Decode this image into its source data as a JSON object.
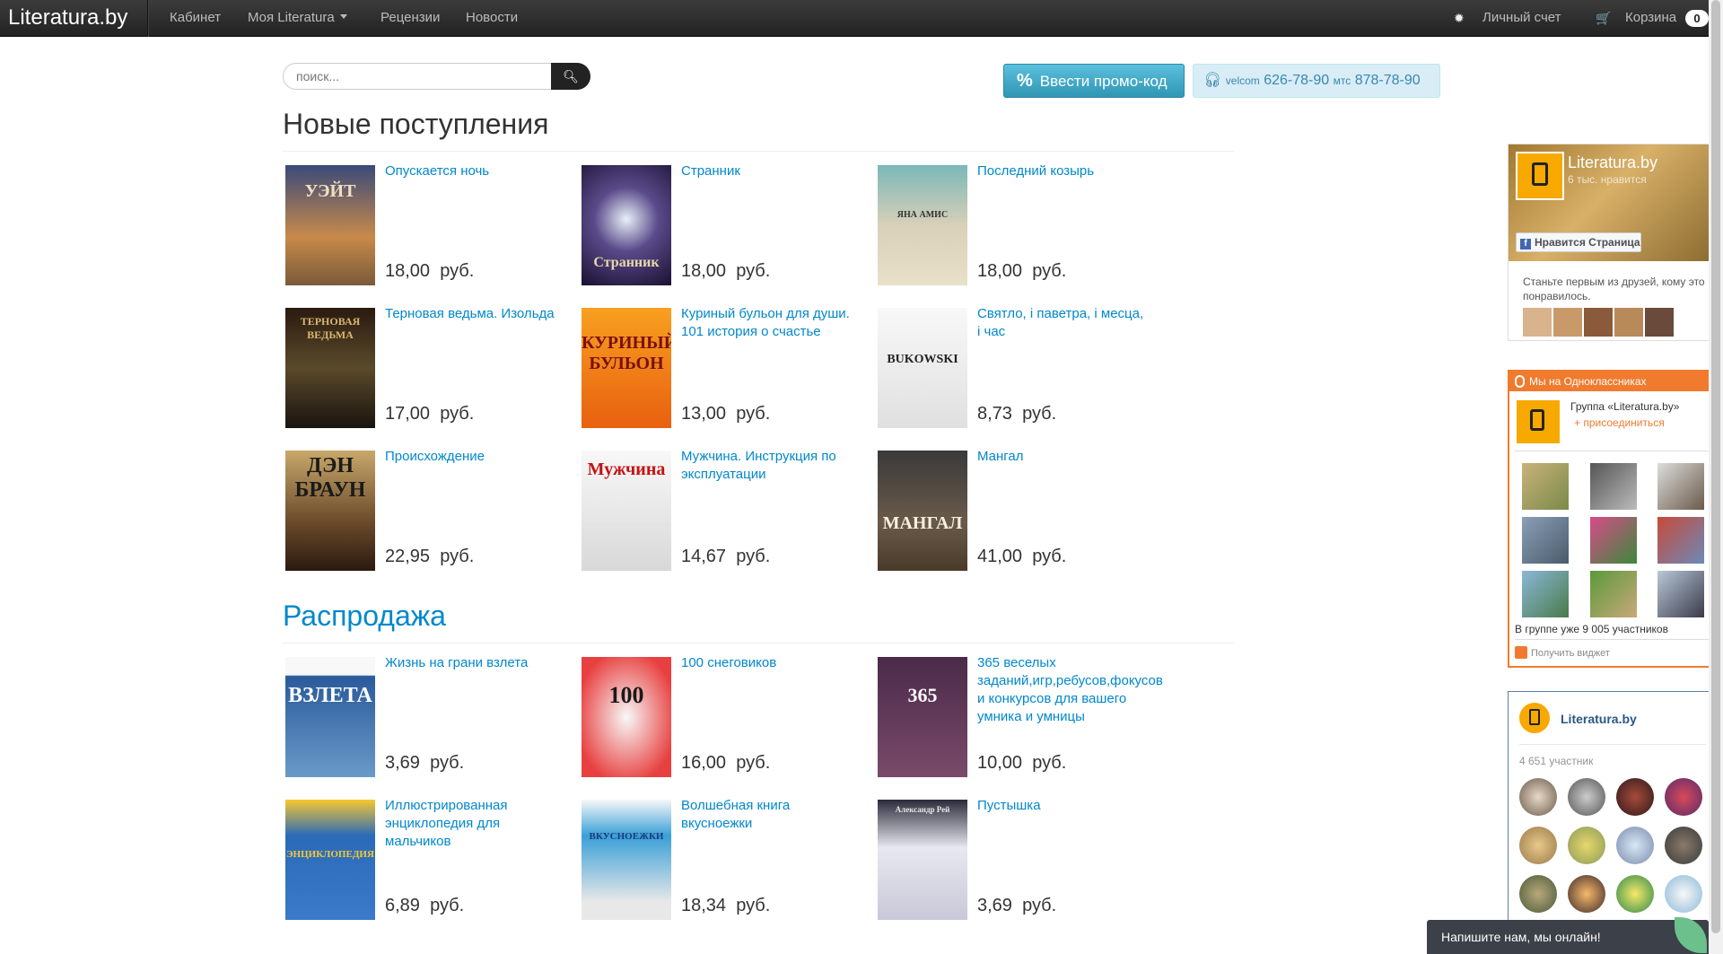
{
  "navbar": {
    "brand": "Literatura.by",
    "links": [
      "Кабинет",
      "Моя Literatura",
      "Рецензии",
      "Новости"
    ],
    "account_label": "Личный счет",
    "cart_label": "Корзина",
    "cart_count": "0"
  },
  "search": {
    "placeholder": "поиск..."
  },
  "promo": {
    "percent": "%",
    "label": "Ввести промо-код"
  },
  "phones": {
    "op1": "velcom",
    "num1": "626-78-90",
    "op2": "мтс",
    "num2": "878-78-90"
  },
  "new_arrivals": {
    "title": "Новые поступления",
    "books": [
      {
        "title": "Опускается ночь",
        "price": "18,00",
        "currency": "руб.",
        "cover_text": "УЭЙТ"
      },
      {
        "title": "Странник",
        "price": "18,00",
        "currency": "руб.",
        "cover_text": "Странник"
      },
      {
        "title": "Последний козырь",
        "price": "18,00",
        "currency": "руб.",
        "cover_text": "ЯНА АМИС"
      },
      {
        "title": "Терновая ведьма. Изольда",
        "price": "17,00",
        "currency": "руб.",
        "cover_text": "ТЕРНОВАЯ ВЕДЬМА"
      },
      {
        "title": "Куриный бульон для души. 101 история о счастье",
        "price": "13,00",
        "currency": "руб.",
        "cover_text": "КУРИНЫЙ БУЛЬОН"
      },
      {
        "title": "Святло, і паветра, і месца, і час",
        "price": "8,73",
        "currency": "руб.",
        "cover_text": "BUKOWSKI"
      },
      {
        "title": "Происхождение",
        "price": "22,95",
        "currency": "руб.",
        "cover_text": "ДЭН БРАУН"
      },
      {
        "title": "Мужчина. Инструкция по эксплуатации",
        "price": "14,67",
        "currency": "руб.",
        "cover_text": "Мужчина"
      },
      {
        "title": "Мангал",
        "price": "41,00",
        "currency": "руб.",
        "cover_text": "МАНГАЛ"
      }
    ]
  },
  "sale": {
    "title": "Распродажа",
    "books": [
      {
        "title": "Жизнь на грани взлета",
        "price": "3,69",
        "currency": "руб.",
        "cover_text": "ВЗЛЕТА"
      },
      {
        "title": "100 снеговиков",
        "price": "16,00",
        "currency": "руб.",
        "cover_text": "100"
      },
      {
        "title": "365 веселых заданий,игр,ребусов,фокусов и конкурсов для вашего умника и умницы",
        "price": "10,00",
        "currency": "руб.",
        "cover_text": "365"
      },
      {
        "title": "Иллюстрированная энциклопедия для мальчиков",
        "price": "6,89",
        "currency": "руб.",
        "cover_text": "ЭНЦИКЛОПЕДИЯ"
      },
      {
        "title": "Волшебная книга вкусноежки",
        "price": "18,34",
        "currency": "руб.",
        "cover_text": "ВКУСНОЕЖКИ"
      },
      {
        "title": "Пустышка",
        "price": "3,69",
        "currency": "руб.",
        "cover_text": "Александр Рей"
      }
    ]
  },
  "facebook": {
    "name": "Literatura.by",
    "likes": "6 тыс. нравится",
    "like_button": "Нравится Страница",
    "text": "Станьте первым из друзей, кому это понравилось."
  },
  "odnoklassniki": {
    "header": "Мы на Одноклассниках",
    "group": "Группа «Literatura.by»",
    "join": "присоединиться",
    "count": "В группе уже 9 005 участников",
    "get_widget": "Получить виджет"
  },
  "vk": {
    "name": "Literatura.by",
    "count": "4 651 участник"
  },
  "chat": {
    "label": "Напишите нам, мы онлайн!"
  }
}
